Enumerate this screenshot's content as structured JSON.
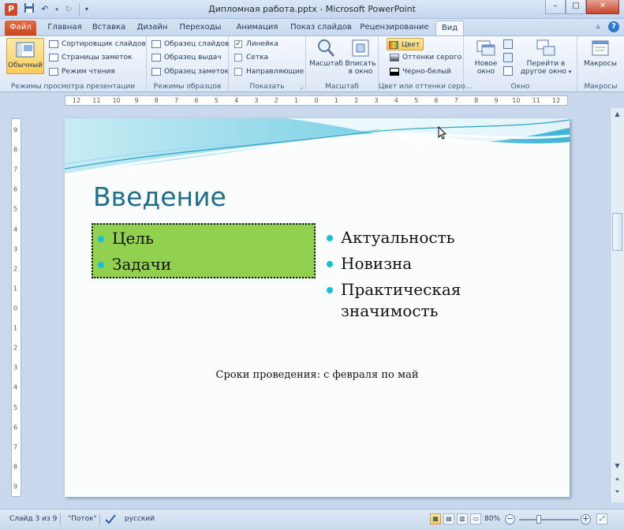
{
  "window": {
    "title": "Дипломная работа.pptx - Microsoft PowerPoint",
    "app_icon": "P",
    "controls": {
      "minimize": "–",
      "maximize": "□",
      "close": "✕"
    }
  },
  "tabs": [
    {
      "label": "Файл",
      "active": false
    },
    {
      "label": "Главная",
      "active": false
    },
    {
      "label": "Вставка",
      "active": false
    },
    {
      "label": "Дизайн",
      "active": false
    },
    {
      "label": "Переходы",
      "active": false
    },
    {
      "label": "Анимация",
      "active": false
    },
    {
      "label": "Показ слайдов",
      "active": false
    },
    {
      "label": "Рецензирование",
      "active": false
    },
    {
      "label": "Вид",
      "active": true
    }
  ],
  "ribbon": {
    "presentation_views": {
      "label": "Режимы просмотра презентации",
      "normal": "Обычный",
      "slide_sorter": "Сортировщик слайдов",
      "notes_page": "Страницы заметок",
      "reading_view": "Режим чтения"
    },
    "master_views": {
      "label": "Режимы образцов",
      "slide_master": "Образец слайдов",
      "handout_master": "Образец выдач",
      "notes_master": "Образец заметок"
    },
    "show": {
      "label": "Показать",
      "ruler": "Линейка",
      "gridlines": "Сетка",
      "guides": "Направляющие",
      "ruler_checked": true
    },
    "zoom": {
      "label": "Масштаб",
      "zoom": "Масштаб",
      "fit_line1": "Вписать",
      "fit_line2": "в окно"
    },
    "color": {
      "label": "Цвет или оттенки серо...",
      "color": "Цвет",
      "grayscale": "Оттенки серого",
      "black_white": "Черно-белый"
    },
    "window_group": {
      "label": "Окно",
      "new_line1": "Новое",
      "new_line2": "окно",
      "switch_line1": "Перейти в",
      "switch_line2": "другое окно"
    },
    "macros": {
      "label": "Макросы",
      "macros": "Макросы"
    }
  },
  "ruler_h": [
    "12",
    "11",
    "10",
    "9",
    "8",
    "7",
    "6",
    "5",
    "4",
    "3",
    "2",
    "1",
    "0",
    "1",
    "2",
    "3",
    "4",
    "5",
    "6",
    "7",
    "8",
    "9",
    "10",
    "11",
    "12"
  ],
  "ruler_v": [
    "9",
    "8",
    "7",
    "6",
    "5",
    "4",
    "3",
    "2",
    "1",
    "0",
    "1",
    "2",
    "3",
    "4",
    "5",
    "6",
    "7",
    "8",
    "9"
  ],
  "slide": {
    "title": "Введение",
    "left_bullets": [
      "Цель",
      "Задачи"
    ],
    "right_bullets": [
      "Актуальность",
      "Новизна",
      "Практическая значимость"
    ],
    "footnote": "Сроки проведения: с февраля по май",
    "colors": {
      "title": "#1f6f8b",
      "bullet": "#17bfd4",
      "highlight": "#92d050"
    }
  },
  "status": {
    "slide": "Слайд 3 из 9",
    "theme": "\"Поток\"",
    "language": "русский",
    "zoom": "80%"
  }
}
